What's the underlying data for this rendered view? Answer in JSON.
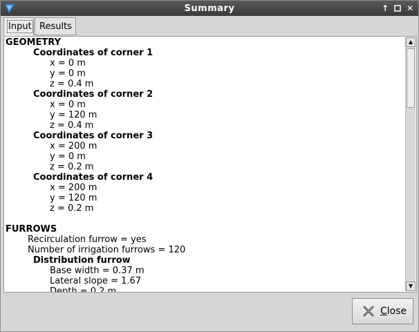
{
  "window": {
    "title": "Summary"
  },
  "tabs": [
    {
      "label": "Input",
      "active": true
    },
    {
      "label": "Results",
      "active": false
    }
  ],
  "summary_lines": [
    {
      "level": "h1",
      "text": "GEOMETRY"
    },
    {
      "level": "h2",
      "text": "Coordinates of corner 1"
    },
    {
      "level": "ind2",
      "text": "x = 0 m"
    },
    {
      "level": "ind2",
      "text": "y = 0 m"
    },
    {
      "level": "ind2",
      "text": "z = 0.4 m"
    },
    {
      "level": "h2",
      "text": "Coordinates of corner 2"
    },
    {
      "level": "ind2",
      "text": "x = 0 m"
    },
    {
      "level": "ind2",
      "text": "y = 120 m"
    },
    {
      "level": "ind2",
      "text": "z = 0.4 m"
    },
    {
      "level": "h2",
      "text": "Coordinates of corner 3"
    },
    {
      "level": "ind2",
      "text": "x = 200 m"
    },
    {
      "level": "ind2",
      "text": "y = 0 m"
    },
    {
      "level": "ind2",
      "text": "z = 0.2 m"
    },
    {
      "level": "h2",
      "text": "Coordinates of corner 4"
    },
    {
      "level": "ind2",
      "text": "x = 200 m"
    },
    {
      "level": "ind2",
      "text": "y = 120 m"
    },
    {
      "level": "ind2",
      "text": "z = 0.2 m"
    },
    {
      "level": "blank",
      "text": ""
    },
    {
      "level": "h1",
      "text": "FURROWS"
    },
    {
      "level": "ind1",
      "text": "Recirculation furrow = yes"
    },
    {
      "level": "ind1",
      "text": "Number of irrigation furrows = 120"
    },
    {
      "level": "h2",
      "text": "Distribution furrow"
    },
    {
      "level": "ind2",
      "text": "Base width = 0.37 m"
    },
    {
      "level": "ind2",
      "text": "Lateral slope = 1.67"
    },
    {
      "level": "ind2",
      "text": "Depth = 0.2 m"
    }
  ],
  "buttons": {
    "close_label": "Close",
    "close_mnemonic": "C",
    "close_rest": "lose"
  },
  "icons": {
    "app": "app-logo-icon",
    "maximize": "arrow-up-icon",
    "restore": "square-icon",
    "close": "close-icon",
    "close_button": "x-icon"
  },
  "colors": {
    "titlebar": "#3f3f3f",
    "content_bg": "#ffffff"
  }
}
